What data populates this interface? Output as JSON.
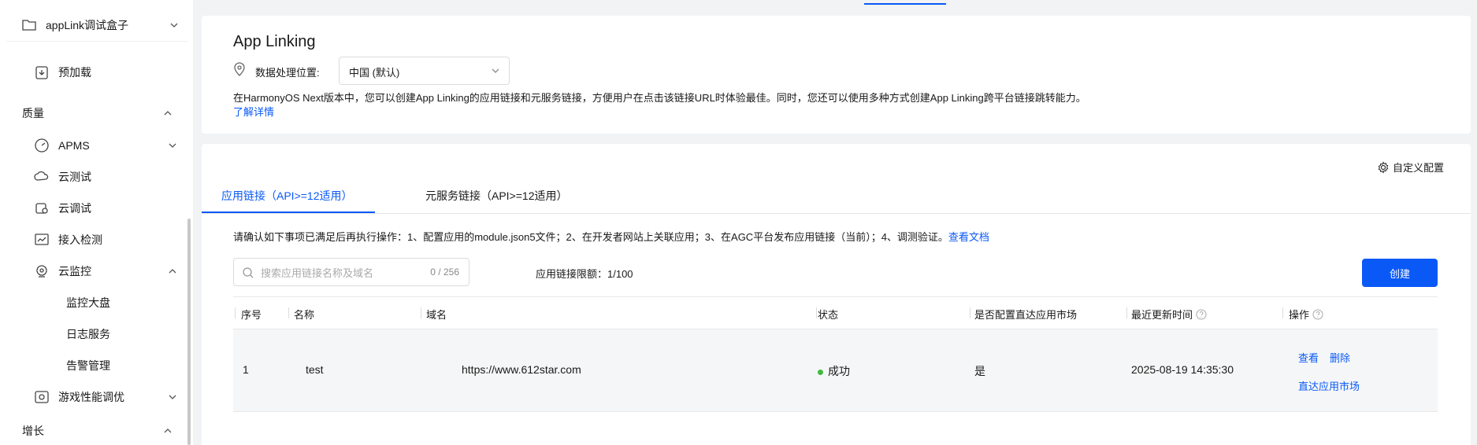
{
  "sidebar": {
    "project": {
      "label": "appLink调试盒子"
    },
    "items": [
      {
        "label": "预加载",
        "icon": "preload-icon"
      },
      {
        "label": "质量",
        "group": true
      },
      {
        "label": "APMS",
        "icon": "dashboard-gauge-icon"
      },
      {
        "label": "云测试",
        "icon": "cloud-test-icon"
      },
      {
        "label": "云调试",
        "icon": "cloud-debug-icon"
      },
      {
        "label": "接入检测",
        "icon": "chart-check-icon"
      },
      {
        "label": "云监控",
        "icon": "monitor-icon"
      },
      {
        "label": "监控大盘"
      },
      {
        "label": "日志服务"
      },
      {
        "label": "告警管理"
      },
      {
        "label": "游戏性能调优",
        "icon": "game-perf-icon"
      },
      {
        "label": "增长",
        "group": true
      }
    ]
  },
  "header": {
    "title": "App Linking",
    "location_label": "数据处理位置:",
    "location_value": "中国 (默认)",
    "description": "在HarmonyOS Next版本中，您可以创建App Linking的应用链接和元服务链接，方便用户在点击该链接URL时体验最佳。同时，您还可以使用多种方式创建App Linking跨平台链接跳转能力。",
    "learn_more": "了解详情"
  },
  "main": {
    "custom_config": "自定义配置",
    "tabs": [
      {
        "label": "应用链接（API>=12适用）",
        "active": true
      },
      {
        "label": "元服务链接（API>=12适用）",
        "active": false
      }
    ],
    "notice": "请确认如下事项已满足后再执行操作：1、配置应用的module.json5文件；2、在开发者网站上关联应用；3、在AGC平台发布应用链接（当前）；4、调测验证。",
    "notice_link": "查看文档",
    "search": {
      "placeholder": "搜索应用链接名称及域名",
      "count": "0 / 256"
    },
    "limit": "应用链接限额：1/100",
    "create": "创建",
    "table": {
      "headers": [
        "序号",
        "名称",
        "域名",
        "状态",
        "是否配置直达应用市场",
        "最近更新时间",
        "操作"
      ],
      "rows": [
        {
          "index": "1",
          "name": "test",
          "domain": "https://www.612star.com",
          "status": "成功",
          "market": "是",
          "updated": "2025-08-19 14:35:30",
          "actions": {
            "view": "查看",
            "delete": "删除",
            "market": "直达应用市场"
          }
        }
      ]
    }
  },
  "colors": {
    "accent": "#0a59f7",
    "success": "#41ba41"
  }
}
